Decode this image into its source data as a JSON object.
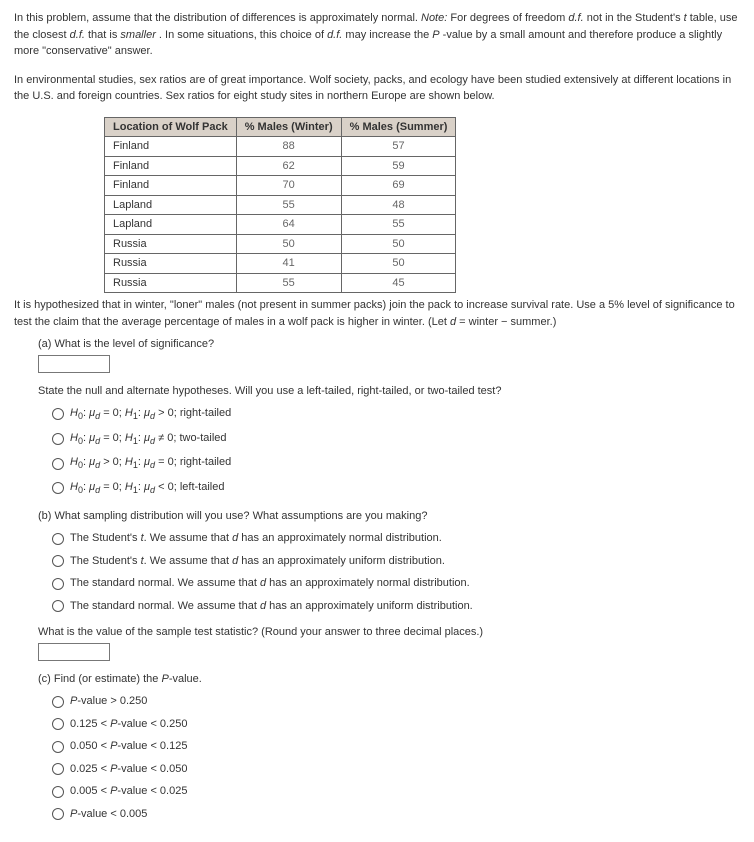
{
  "intro": {
    "p1_a": "In this problem, assume that the distribution of differences is approximately normal. ",
    "p1_note_label": "Note:",
    "p1_b": " For degrees of freedom ",
    "p1_df": "d.f.",
    "p1_c": " not in the Student's ",
    "p1_t": "t",
    "p1_d": " table, use the closest ",
    "p1_e": " that is ",
    "p1_smaller": "smaller",
    "p1_f": ". In some situations, this choice of ",
    "p1_g": " may increase the ",
    "p1_pval": "P",
    "p1_h": "-value by a small amount and therefore produce a slightly more \"conservative\" answer.",
    "p2": "In environmental studies, sex ratios are of great importance. Wolf society, packs, and ecology have been studied extensively at different locations in the U.S. and foreign countries. Sex ratios for eight study sites in northern Europe are shown below."
  },
  "chart_data": {
    "type": "table",
    "headers": [
      "Location of Wolf Pack",
      "% Males (Winter)",
      "% Males (Summer)"
    ],
    "rows": [
      [
        "Finland",
        88,
        57
      ],
      [
        "Finland",
        62,
        59
      ],
      [
        "Finland",
        70,
        69
      ],
      [
        "Lapland",
        55,
        48
      ],
      [
        "Lapland",
        64,
        55
      ],
      [
        "Russia",
        50,
        50
      ],
      [
        "Russia",
        41,
        50
      ],
      [
        "Russia",
        55,
        45
      ]
    ]
  },
  "hypothesis": {
    "text_a": "It is hypothesized that in winter, \"loner\" males (not present in summer packs) join the pack to increase survival rate. Use a 5% level of significance to test the claim that the average percentage of males in a wolf pack is higher in winter. (Let ",
    "text_d": "d",
    "text_b": " = winter − summer.)"
  },
  "qa": {
    "label": "(a) What is the level of significance?",
    "hyp_prompt": "State the null and alternate hypotheses. Will you use a left-tailed, right-tailed, or two-tailed test?",
    "options": [
      "H₀: μ_d = 0; H₁: μ_d > 0; right-tailed",
      "H₀: μ_d = 0; H₁: μ_d ≠ 0; two-tailed",
      "H₀: μ_d > 0; H₁: μ_d = 0; right-tailed",
      "H₀: μ_d = 0; H₁: μ_d < 0; left-tailed"
    ]
  },
  "qb": {
    "label": "(b) What sampling distribution will you use? What assumptions are you making?",
    "options": [
      "The Student's t. We assume that d has an approximately normal distribution.",
      "The Student's t. We assume that d has an approximately uniform distribution.",
      "The standard normal. We assume that d has an approximately normal distribution.",
      "The standard normal. We assume that d has an approximately uniform distribution."
    ],
    "stat_prompt": "What is the value of the sample test statistic? (Round your answer to three decimal places.)"
  },
  "qc": {
    "label": "(c) Find (or estimate) the P-value.",
    "options": [
      "P-value > 0.250",
      "0.125 < P-value < 0.250",
      "0.050 < P-value < 0.125",
      "0.025 < P-value < 0.050",
      "0.005 < P-value < 0.025",
      "P-value < 0.005"
    ]
  }
}
